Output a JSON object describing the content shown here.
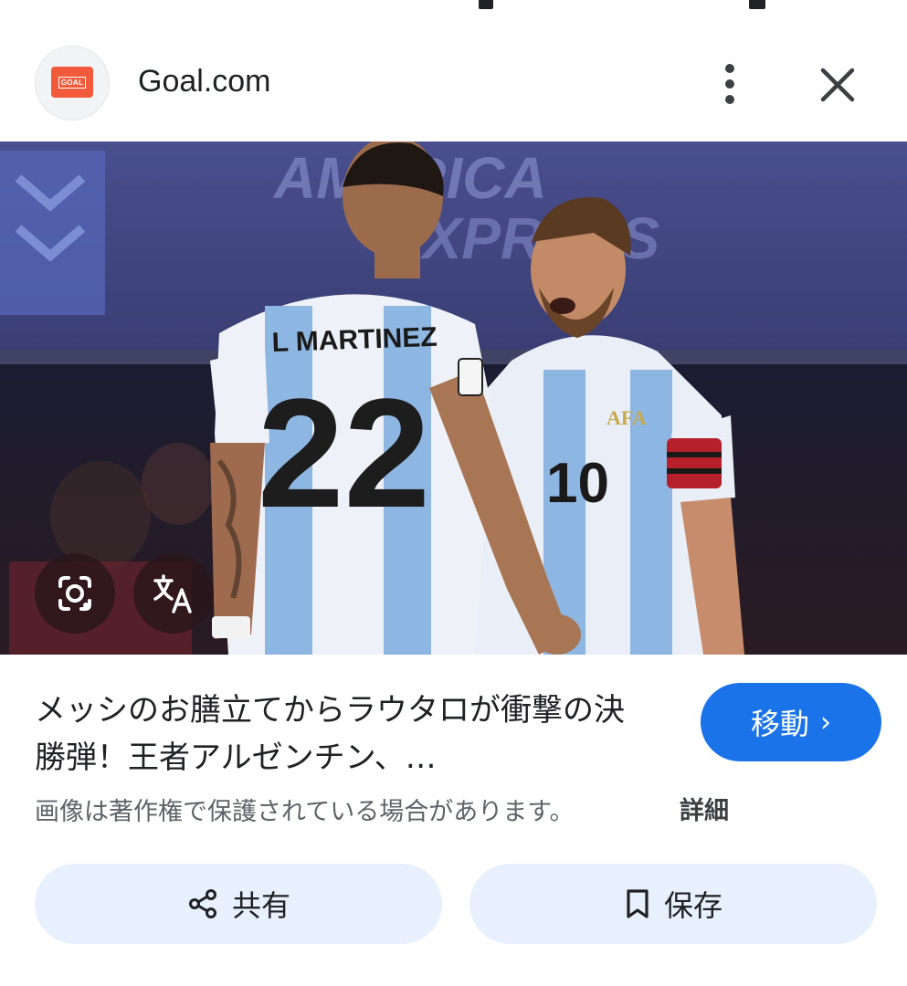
{
  "header": {
    "logo_text": "GOAL",
    "source_name": "Goal.com",
    "icons": {
      "logo": "goal-logo",
      "more": "more-vert-icon",
      "close": "close-icon"
    }
  },
  "hero": {
    "jersey_back_name": "L MARTINEZ",
    "jersey_back_number": "22",
    "jersey_front_number": "10",
    "crest_text": "AFA",
    "banner_text": "AMERICA EXPRESS",
    "overlay_icons": [
      "google-lens-icon",
      "translate-icon"
    ]
  },
  "result": {
    "title": "メッシのお膳立てからラウタロが衝撃の決勝弾！王者アルゼンチン、…",
    "go_button_label": "移動",
    "go_button_chevron": "›",
    "copyright_notice": "画像は著作権で保護されている場合があります。",
    "details_link": "詳細"
  },
  "actions": {
    "share_label": "共有",
    "save_label": "保存",
    "icons": {
      "share": "share-icon",
      "save": "bookmark-icon"
    }
  },
  "colors": {
    "accent": "#1a73e8",
    "action_button_bg": "#e8f0fe",
    "logo_brand": "#f15a3b"
  }
}
